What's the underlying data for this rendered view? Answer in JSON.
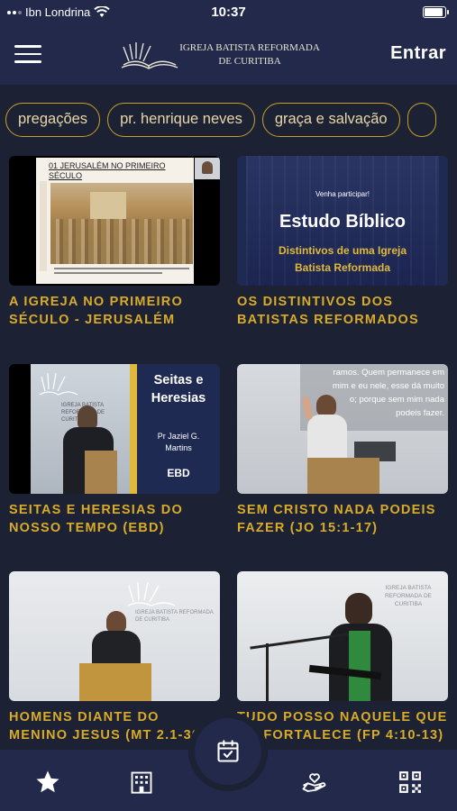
{
  "status_bar": {
    "carrier": "Ibn Londrina",
    "time": "10:37"
  },
  "header": {
    "logo_line1": "IGREJA BATISTA REFORMADA",
    "logo_line2": "DE CURITIBA",
    "login_label": "Entrar"
  },
  "chips": [
    "pregações",
    "pr. henrique neves",
    "graça e salvação"
  ],
  "cards": [
    {
      "title": "A IGREJA NO PRIMEIRO SÉCULO - JERUSALÉM",
      "thumb_heading": "01 JERUSALÉM NO PRIMEIRO SÉCULO"
    },
    {
      "title": "OS DISTINTIVOS DOS BATISTAS REFORMADOS",
      "thumb_kicker": "Venha participar!",
      "thumb_heading": "Estudo Bíblico",
      "thumb_sub1": "Distintivos de uma Igreja",
      "thumb_sub2": "Batista Reformada"
    },
    {
      "title": "SEITAS E HERESIAS DO NOSSO TEMPO (EBD)",
      "thumb_heading1": "Seitas e",
      "thumb_heading2": "Heresias",
      "thumb_speaker1": "Pr Jaziel G.",
      "thumb_speaker2": "Martins",
      "thumb_tag": "EBD"
    },
    {
      "title": "SEM CRISTO NADA PODEIS FAZER (JO 15:1-17)",
      "thumb_line1": "ramos. Quem permanece em",
      "thumb_line2": "mim e eu nele, esse dá muito",
      "thumb_line3": "o; porque sem mim nada",
      "thumb_line4": "podeis fazer."
    },
    {
      "title": "HOMENS DIANTE DO MENINO JESUS (MT 2.1-30)"
    },
    {
      "title": "TUDO POSSO NAQUELE QUE ME FORTALECE (FP 4:10-13)"
    }
  ],
  "nav": [
    "star-icon",
    "building-icon",
    "calendar-check-icon",
    "hand-heart-icon",
    "qr-code-icon"
  ],
  "colors": {
    "background": "#1c2233",
    "bar": "#22294a",
    "accent": "#d9ab2a",
    "chip_border": "#c99f2a"
  }
}
